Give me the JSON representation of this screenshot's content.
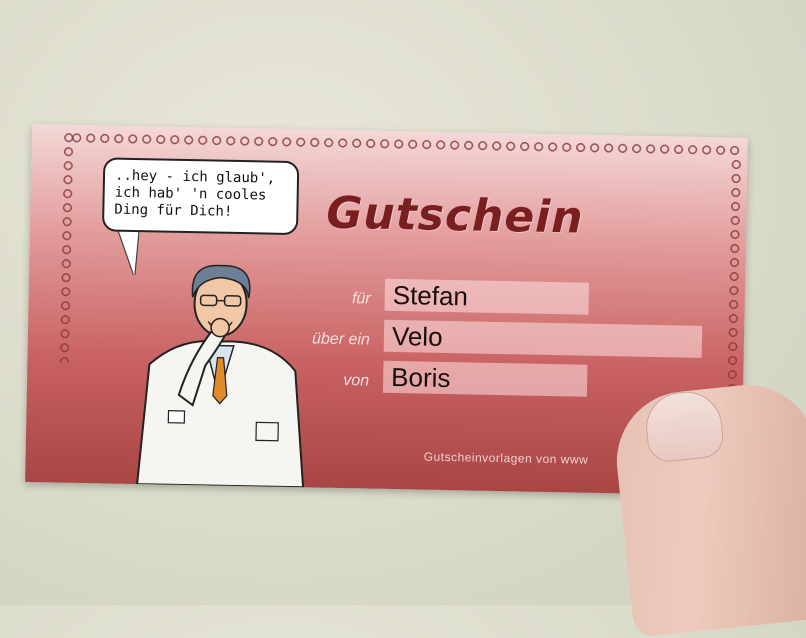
{
  "voucher": {
    "speech_bubble_lines": [
      "..hey - ich glaub',",
      "ich hab' 'n cooles",
      "Ding für Dich!"
    ],
    "title": "Gutschein",
    "fields": [
      {
        "label": "für",
        "value": "Stefan"
      },
      {
        "label": "über ein",
        "value": "Velo"
      },
      {
        "label": "von",
        "value": "Boris"
      }
    ],
    "footer_text": "Gutscheinvorlagen von www"
  },
  "colors": {
    "card_top": "#f4d8d8",
    "card_bottom": "#a94545",
    "title": "#7a1f1f",
    "background": "#dcdccb"
  }
}
